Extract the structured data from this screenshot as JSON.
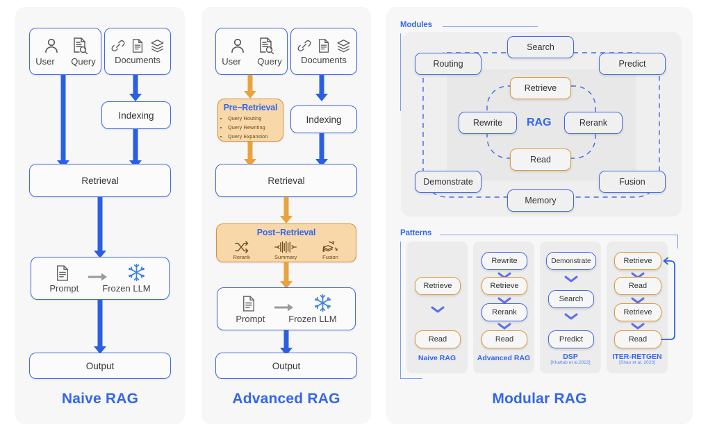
{
  "figure": {
    "panels": [
      {
        "id": "naive",
        "title": "Naive RAG",
        "nodes": {
          "user": "User",
          "query": "Query",
          "documents": "Documents",
          "indexing": "Indexing",
          "retrieval": "Retrieval",
          "prompt": "Prompt",
          "frozen_llm": "Frozen LLM",
          "output": "Output"
        },
        "icons": [
          "user-icon",
          "query-document-search-icon",
          "link-icon",
          "document-icon",
          "layers-icon",
          "document-icon",
          "arrow-right-icon",
          "snowflake-icon"
        ]
      },
      {
        "id": "advanced",
        "title": "Advanced RAG",
        "nodes": {
          "user": "User",
          "query": "Query",
          "documents": "Documents",
          "indexing": "Indexing",
          "retrieval": "Retrieval",
          "prompt": "Prompt",
          "frozen_llm": "Frozen LLM",
          "output": "Output"
        },
        "pre_retrieval": {
          "title": "Pre−Retrieval",
          "items": [
            "Query Routing",
            "Query Rewriting",
            "Query Expansion"
          ]
        },
        "post_retrieval": {
          "title": "Post−Retrieval",
          "items": [
            {
              "label": "Rerank",
              "icon": "shuffle-icon"
            },
            {
              "label": "Summary",
              "icon": "compress-icon"
            },
            {
              "label": "Fusion",
              "icon": "fusion-stack-icon"
            }
          ]
        }
      },
      {
        "id": "modular",
        "title": "Modular RAG",
        "sections": {
          "modules": {
            "label": "Modules",
            "center": "RAG",
            "outer": [
              "Search",
              "Routing",
              "Predict",
              "Demonstrate",
              "Fusion",
              "Memory"
            ],
            "inner": [
              "Retrieve",
              "Rewrite",
              "Rerank",
              "Read"
            ],
            "amber_nodes": [
              "Retrieve",
              "Read"
            ]
          },
          "patterns": {
            "label": "Patterns",
            "columns": [
              {
                "caption": "Naive RAG",
                "citation": "",
                "steps": [
                  {
                    "label": "Retrieve",
                    "color": "amber"
                  },
                  {
                    "label": "Read",
                    "color": "amber"
                  }
                ]
              },
              {
                "caption": "Advanced RAG",
                "citation": "",
                "steps": [
                  {
                    "label": "Rewrite",
                    "color": "blue"
                  },
                  {
                    "label": "Retrieve",
                    "color": "amber"
                  },
                  {
                    "label": "Rerank",
                    "color": "blue"
                  },
                  {
                    "label": "Read",
                    "color": "amber"
                  }
                ]
              },
              {
                "caption": "DSP",
                "citation": "[Khattab et al.2022]",
                "steps": [
                  {
                    "label": "Demonstrate",
                    "color": "blue"
                  },
                  {
                    "label": "Search",
                    "color": "blue"
                  },
                  {
                    "label": "Predict",
                    "color": "blue"
                  }
                ]
              },
              {
                "caption": "ITER-RETGEN",
                "citation": "[Shao et al. 2023]",
                "steps": [
                  {
                    "label": "Retrieve",
                    "color": "amber"
                  },
                  {
                    "label": "Read",
                    "color": "amber"
                  },
                  {
                    "label": "Retrieve",
                    "color": "amber"
                  },
                  {
                    "label": "Read",
                    "color": "amber"
                  }
                ],
                "loop": true
              }
            ]
          }
        }
      }
    ],
    "colors": {
      "accent_blue": "#3366ee",
      "node_border_blue": "#4169e1",
      "arrow_blue": "#2b5fe3",
      "accent_orange": "#e09a35",
      "orange_fill": "#f8d7a8",
      "panel_bg": "#f7f7f7"
    }
  }
}
